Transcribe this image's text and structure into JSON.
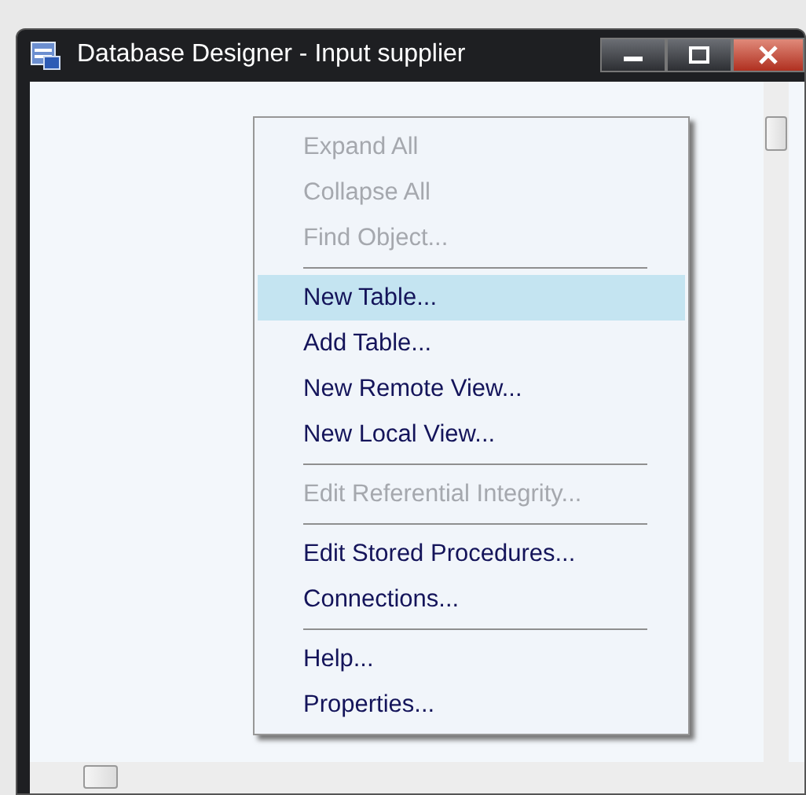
{
  "window": {
    "title": "Database Designer - Input supplier"
  },
  "context_menu": {
    "items": [
      {
        "kind": "item",
        "label": "Expand All",
        "disabled": true,
        "selected": false
      },
      {
        "kind": "item",
        "label": "Collapse All",
        "disabled": true,
        "selected": false
      },
      {
        "kind": "item",
        "label": "Find Object...",
        "disabled": true,
        "selected": false
      },
      {
        "kind": "separator"
      },
      {
        "kind": "item",
        "label": "New Table...",
        "disabled": false,
        "selected": true
      },
      {
        "kind": "item",
        "label": "Add Table...",
        "disabled": false,
        "selected": false
      },
      {
        "kind": "item",
        "label": "New Remote View...",
        "disabled": false,
        "selected": false
      },
      {
        "kind": "item",
        "label": "New Local View...",
        "disabled": false,
        "selected": false
      },
      {
        "kind": "separator"
      },
      {
        "kind": "item",
        "label": "Edit Referential Integrity...",
        "disabled": true,
        "selected": false
      },
      {
        "kind": "separator"
      },
      {
        "kind": "item",
        "label": "Edit Stored Procedures...",
        "disabled": false,
        "selected": false
      },
      {
        "kind": "item",
        "label": "Connections...",
        "disabled": false,
        "selected": false
      },
      {
        "kind": "separator"
      },
      {
        "kind": "item",
        "label": "Help...",
        "disabled": false,
        "selected": false
      },
      {
        "kind": "item",
        "label": "Properties...",
        "disabled": false,
        "selected": false
      }
    ]
  }
}
